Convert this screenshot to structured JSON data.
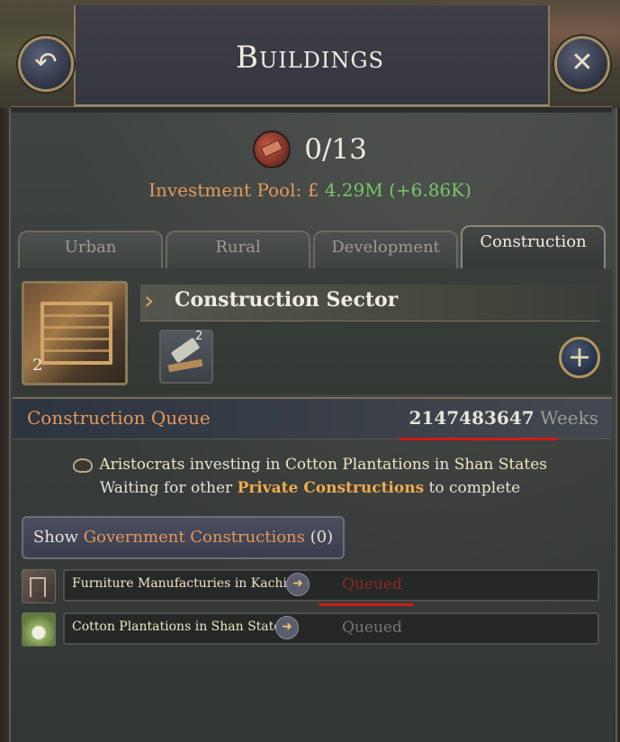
{
  "header": {
    "title": "Buildings",
    "back_icon": "back-arrow-icon",
    "close_icon": "close-icon"
  },
  "stats": {
    "construction_count": "0/13",
    "investment_label": "Investment Pool:",
    "currency_symbol": "£",
    "investment_value": "4.29M",
    "investment_change": "(+6.86K)"
  },
  "tabs": [
    {
      "label": "Urban",
      "active": false
    },
    {
      "label": "Rural",
      "active": false
    },
    {
      "label": "Development",
      "active": false
    },
    {
      "label": "Construction",
      "active": true
    }
  ],
  "sector": {
    "title": "Construction Sector",
    "level": "2",
    "method_count": "2"
  },
  "queue": {
    "title": "Construction Queue",
    "weeks_value": "2147483647",
    "weeks_unit": "Weeks"
  },
  "info": {
    "line1_who": "Aristocrats",
    "line1_mid": "investing in",
    "line1_building": "Cotton Plantations",
    "line1_in": "in",
    "line1_place": "Shan States",
    "line2_prefix": "Waiting for other",
    "line2_highlight": "Private Constructions",
    "line2_suffix": "to complete"
  },
  "show_government": {
    "prefix": "Show",
    "highlight": "Government Constructions",
    "count": "(0)"
  },
  "queue_items": [
    {
      "building": "Furniture Manufacturies",
      "in": "in",
      "place": "Kachin",
      "status": "Queued",
      "status_color": "#8c2a22"
    },
    {
      "building": "Cotton Plantations",
      "in": "in",
      "place": "Shan States",
      "status": "Queued",
      "status_color": "#77776f"
    }
  ],
  "colors": {
    "accent_orange": "#e3985b",
    "positive_green": "#79c46a",
    "highlight_gold": "#f0aa4e",
    "annotation_red": "#d01a1a"
  }
}
